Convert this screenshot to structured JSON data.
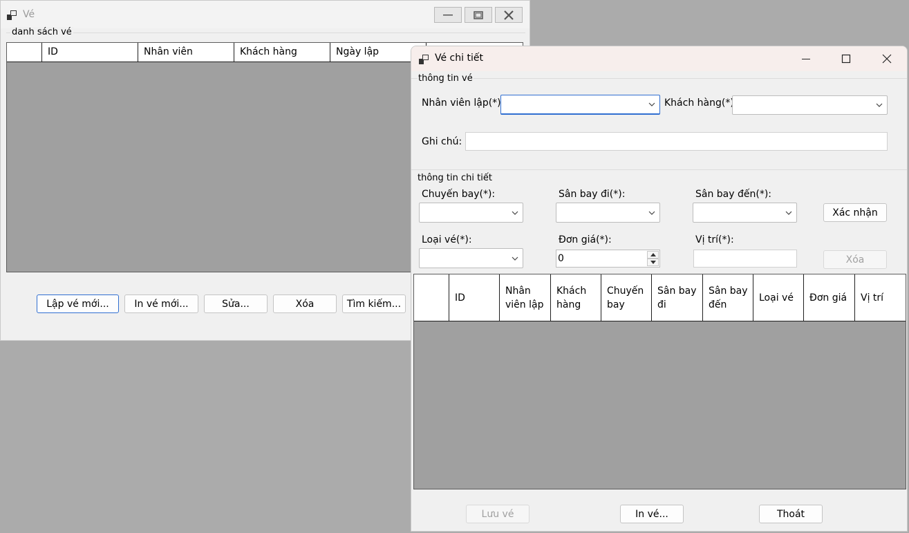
{
  "ve_window": {
    "title": "Vé",
    "group_label": "danh sách vé",
    "grid_columns": [
      "",
      "ID",
      "Nhân viên",
      "Khách hàng",
      "Ngày lập",
      ""
    ],
    "buttons": {
      "lap_ve_moi": "Lập vé mới...",
      "in_ve_moi": "In vé mới...",
      "sua": "Sửa...",
      "xoa": "Xóa",
      "tim_kiem": "Tìm kiếm..."
    }
  },
  "detail_window": {
    "title": "Vé chi tiết",
    "thong_tin_ve": {
      "group_label": "thông tin vé",
      "nhan_vien_lap_label": "Nhân viên lập(*):",
      "khach_hang_label": "Khách hàng(*):",
      "ghi_chu_label": "Ghi chú:",
      "nhan_vien_lap_value": "",
      "khach_hang_value": "",
      "ghi_chu_value": ""
    },
    "thong_tin_chi_tiet": {
      "group_label": "thông tin chi tiết",
      "chuyen_bay_label": "Chuyến bay(*):",
      "san_bay_di_label": "Sân bay đi(*):",
      "san_bay_den_label": "Sân bay đến(*):",
      "loai_ve_label": "Loại vé(*):",
      "don_gia_label": "Đơn giá(*):",
      "vi_tri_label": "Vị trí(*):",
      "don_gia_value": "0",
      "xac_nhan_button": "Xác nhận",
      "xoa_button": "Xóa"
    },
    "grid_columns": [
      "",
      "ID",
      "Nhân viên lập",
      "Khách hàng",
      "Chuyến bay",
      "Sân bay đi",
      "Sân bay đến",
      "Loại vé",
      "Đơn giá",
      "Vị trí"
    ],
    "buttons": {
      "luu_ve": "Lưu vé",
      "in_ve": "In vé...",
      "thoat": "Thoát"
    }
  },
  "colors": {
    "desktop": "#ababab",
    "window_bg": "#f0f0f0",
    "grid_empty": "#a0a0a0",
    "focus_accent": "#2f6ed1",
    "detail_titlebar": "#f7eeec"
  }
}
